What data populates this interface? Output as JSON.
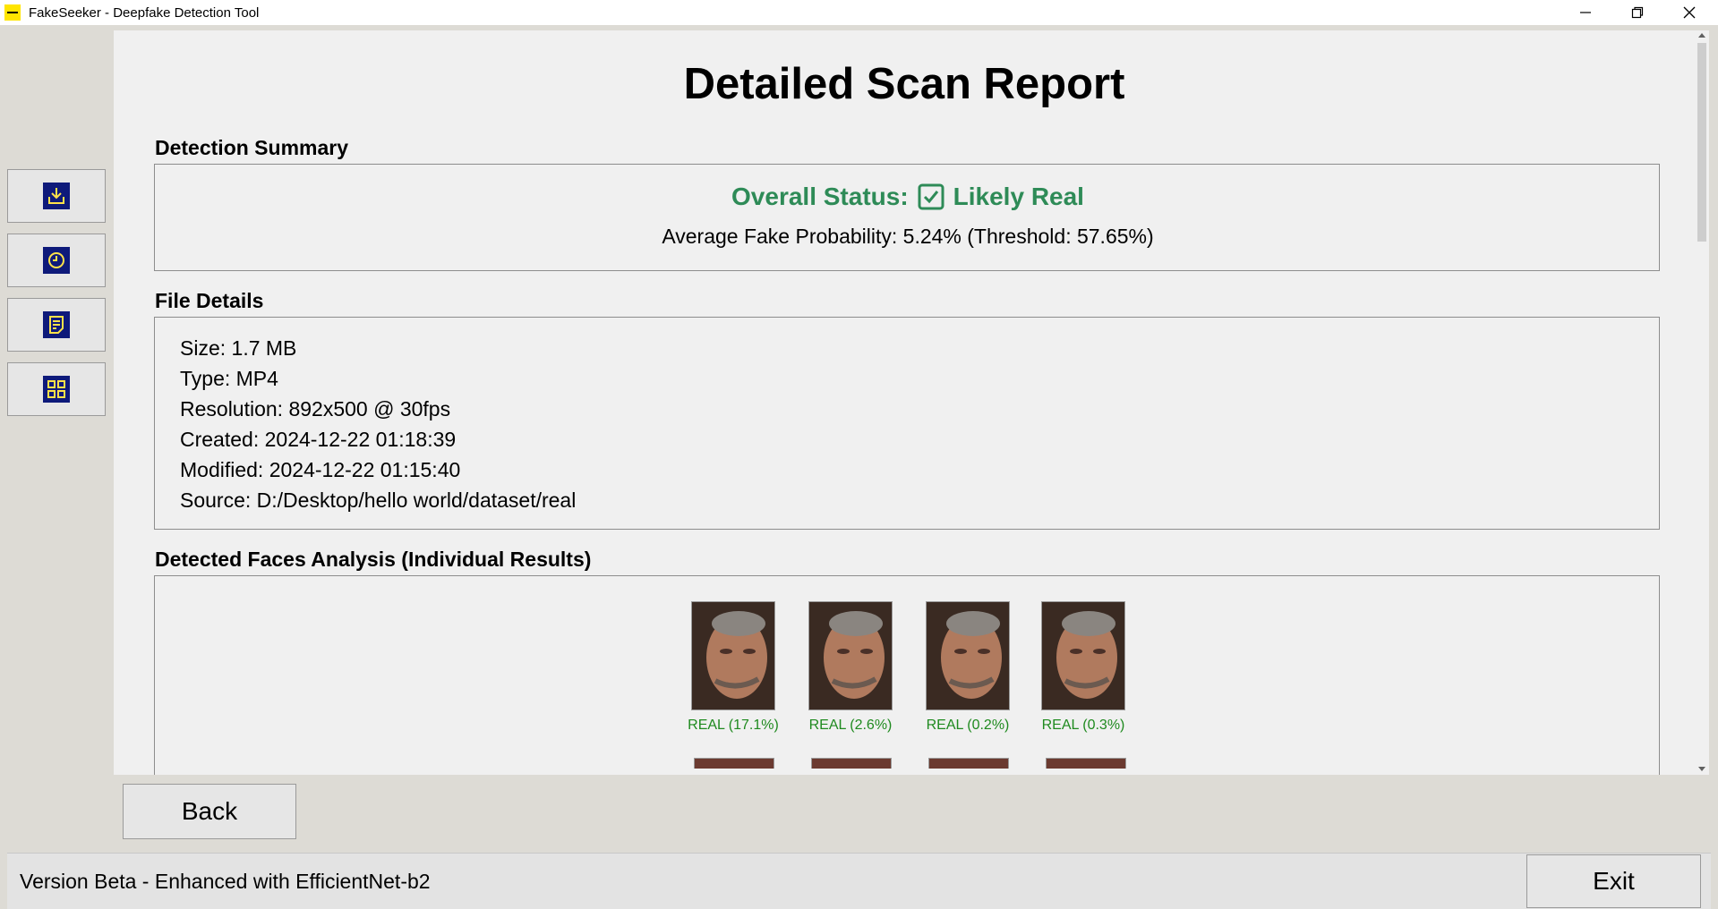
{
  "window": {
    "title": "FakeSeeker - Deepfake Detection Tool",
    "minimize_icon": "minimize-icon",
    "maximize_icon": "restore-icon",
    "close_icon": "close-icon"
  },
  "sidebar": {
    "items": [
      {
        "icon": "download-icon"
      },
      {
        "icon": "history-icon"
      },
      {
        "icon": "report-icon"
      },
      {
        "icon": "grid-icon"
      }
    ],
    "icon_bg": "#0e1a7a",
    "icon_fg": "#ffe24a"
  },
  "report": {
    "title": "Detailed Scan Report",
    "summary": {
      "heading": "Detection Summary",
      "status_label": "Overall Status:",
      "status_value": "Likely Real",
      "status_color": "#2e8b57",
      "probability_line": "Average Fake Probability: 5.24% (Threshold: 57.65%)"
    },
    "file_details": {
      "heading": "File Details",
      "lines": [
        "Size: 1.7 MB",
        "Type: MP4",
        "Resolution: 892x500 @ 30fps",
        "Created: 2024-12-22 01:18:39",
        "Modified: 2024-12-22 01:15:40",
        "Source: D:/Desktop/hello world/dataset/real"
      ]
    },
    "faces": {
      "heading": "Detected Faces Analysis (Individual Results)",
      "label_color": "#1f8a1f",
      "items": [
        {
          "label": "REAL (17.1%)"
        },
        {
          "label": "REAL (2.6%)"
        },
        {
          "label": "REAL (0.2%)"
        },
        {
          "label": "REAL (0.3%)"
        }
      ]
    }
  },
  "buttons": {
    "back": "Back",
    "exit": "Exit"
  },
  "footer": {
    "version": "Version Beta - Enhanced with EfficientNet-b2"
  }
}
